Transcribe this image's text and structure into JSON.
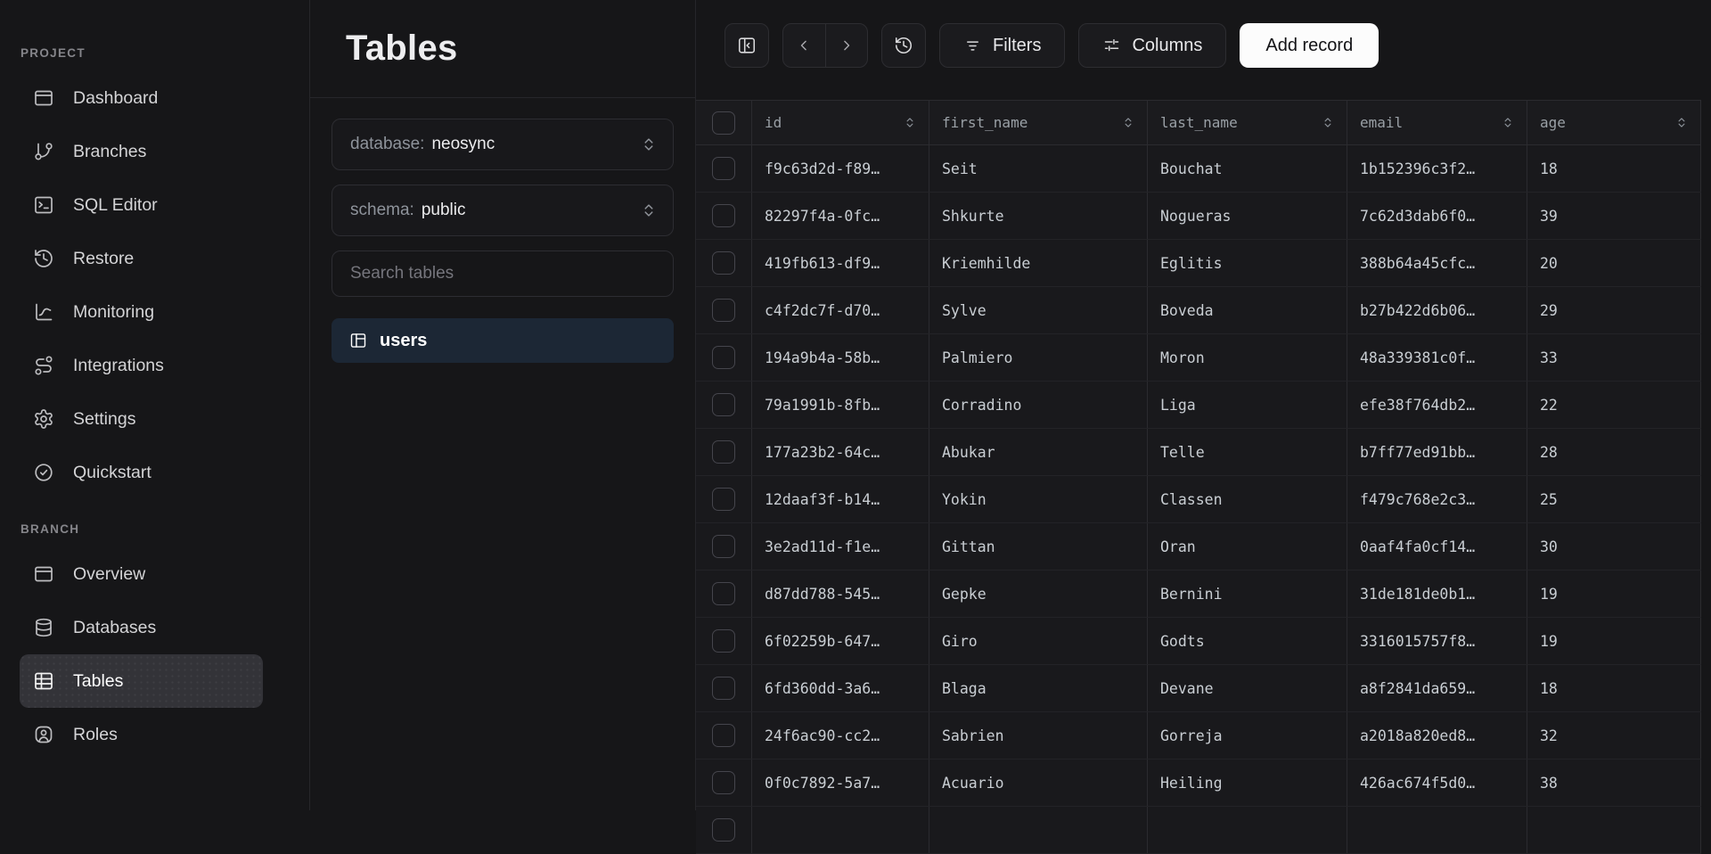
{
  "sidebar": {
    "sections": [
      {
        "label": "PROJECT",
        "items": [
          {
            "label": "Dashboard",
            "icon": "browser"
          },
          {
            "label": "Branches",
            "icon": "git-branch"
          },
          {
            "label": "SQL Editor",
            "icon": "terminal"
          },
          {
            "label": "Restore",
            "icon": "history"
          },
          {
            "label": "Monitoring",
            "icon": "chart"
          },
          {
            "label": "Integrations",
            "icon": "route"
          },
          {
            "label": "Settings",
            "icon": "gear"
          },
          {
            "label": "Quickstart",
            "icon": "check-circle"
          }
        ]
      },
      {
        "label": "BRANCH",
        "items": [
          {
            "label": "Overview",
            "icon": "browser"
          },
          {
            "label": "Databases",
            "icon": "database"
          },
          {
            "label": "Tables",
            "icon": "table-grid",
            "active": true
          },
          {
            "label": "Roles",
            "icon": "shield-user"
          }
        ]
      }
    ]
  },
  "tables_panel": {
    "title": "Tables",
    "database_select": {
      "label": "database:",
      "value": "neosync"
    },
    "schema_select": {
      "label": "schema:",
      "value": "public"
    },
    "search_placeholder": "Search tables",
    "tables": [
      {
        "name": "users",
        "icon": "table-split",
        "selected": true
      }
    ]
  },
  "toolbar": {
    "filters_label": "Filters",
    "columns_label": "Columns",
    "add_record_label": "Add record"
  },
  "grid": {
    "columns": [
      "id",
      "first_name",
      "last_name",
      "email",
      "age"
    ],
    "rows": [
      {
        "id": "f9c63d2d-f89…",
        "first_name": "Seit",
        "last_name": "Bouchat",
        "email": "1b152396c3f2…",
        "age": "18"
      },
      {
        "id": "82297f4a-0fc…",
        "first_name": "Shkurte",
        "last_name": "Nogueras",
        "email": "7c62d3dab6f0…",
        "age": "39"
      },
      {
        "id": "419fb613-df9…",
        "first_name": "Kriemhilde",
        "last_name": "Eglitis",
        "email": "388b64a45cfc…",
        "age": "20"
      },
      {
        "id": "c4f2dc7f-d70…",
        "first_name": "Sylve",
        "last_name": "Boveda",
        "email": "b27b422d6b06…",
        "age": "29"
      },
      {
        "id": "194a9b4a-58b…",
        "first_name": "Palmiero",
        "last_name": "Moron",
        "email": "48a339381c0f…",
        "age": "33"
      },
      {
        "id": "79a1991b-8fb…",
        "first_name": "Corradino",
        "last_name": "Liga",
        "email": "efe38f764db2…",
        "age": "22"
      },
      {
        "id": "177a23b2-64c…",
        "first_name": "Abukar",
        "last_name": "Telle",
        "email": "b7ff77ed91bb…",
        "age": "28"
      },
      {
        "id": "12daaf3f-b14…",
        "first_name": "Yokin",
        "last_name": "Classen",
        "email": "f479c768e2c3…",
        "age": "25"
      },
      {
        "id": "3e2ad11d-f1e…",
        "first_name": "Gittan",
        "last_name": "Oran",
        "email": "0aaf4fa0cf14…",
        "age": "30"
      },
      {
        "id": "d87dd788-545…",
        "first_name": "Gepke",
        "last_name": "Bernini",
        "email": "31de181de0b1…",
        "age": "19"
      },
      {
        "id": "6f02259b-647…",
        "first_name": "Giro",
        "last_name": "Godts",
        "email": "3316015757f8…",
        "age": "19"
      },
      {
        "id": "6fd360dd-3a6…",
        "first_name": "Blaga",
        "last_name": "Devane",
        "email": "a8f2841da659…",
        "age": "18"
      },
      {
        "id": "24f6ac90-cc2…",
        "first_name": "Sabrien",
        "last_name": "Gorreja",
        "email": "a2018a820ed8…",
        "age": "32"
      },
      {
        "id": "0f0c7892-5a7…",
        "first_name": "Acuario",
        "last_name": "Heiling",
        "email": "426ac674f5d0…",
        "age": "38"
      }
    ]
  },
  "colors": {
    "background": "#161618",
    "panel_border": "#26262a",
    "selected_table_bg": "#1c2735",
    "selected_nav_bg": "#333338",
    "add_record_bg": "#fcfcfc",
    "add_record_text": "#131316",
    "cell_text": "#c9ced3",
    "header_text": "#9aa0a6"
  }
}
